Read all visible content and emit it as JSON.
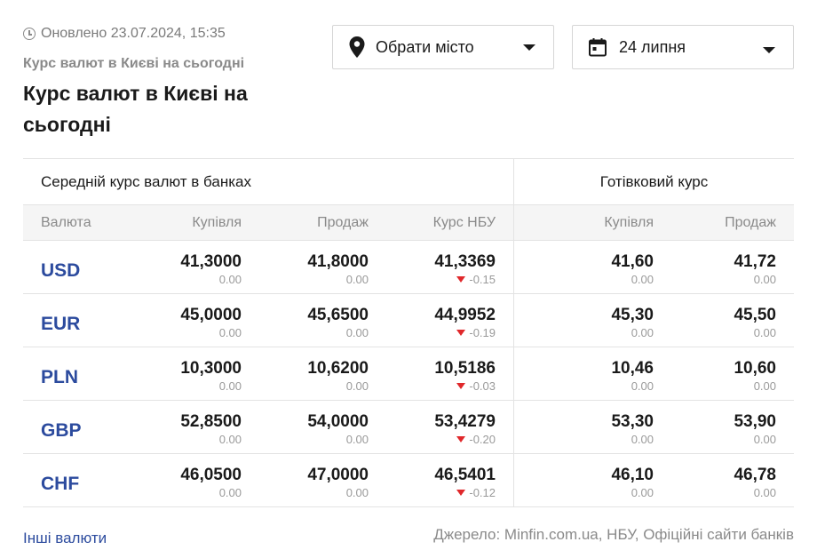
{
  "header": {
    "updated": "Оновлено 23.07.2024, 15:35",
    "breadcrumb": "Курс валют в Києві на сьогодні",
    "title": "Курс валют в Києві на сьогодні"
  },
  "filters": {
    "city_label": "Обрати місто",
    "date_label": "24 липня"
  },
  "table": {
    "bank_section": "Середній курс валют в банках",
    "cash_section": "Готівковий курс",
    "columns": {
      "currency": "Валюта",
      "buy": "Купівля",
      "sell": "Продаж",
      "nbu": "Курс НБУ",
      "cash_buy": "Купівля",
      "cash_sell": "Продаж"
    },
    "rows": [
      {
        "code": "USD",
        "buy": "41,3000",
        "buy_chg": "0.00",
        "sell": "41,8000",
        "sell_chg": "0.00",
        "nbu": "41,3369",
        "nbu_chg": "-0.15",
        "cash_buy": "41,60",
        "cash_buy_chg": "0.00",
        "cash_sell": "41,72",
        "cash_sell_chg": "0.00"
      },
      {
        "code": "EUR",
        "buy": "45,0000",
        "buy_chg": "0.00",
        "sell": "45,6500",
        "sell_chg": "0.00",
        "nbu": "44,9952",
        "nbu_chg": "-0.19",
        "cash_buy": "45,30",
        "cash_buy_chg": "0.00",
        "cash_sell": "45,50",
        "cash_sell_chg": "0.00"
      },
      {
        "code": "PLN",
        "buy": "10,3000",
        "buy_chg": "0.00",
        "sell": "10,6200",
        "sell_chg": "0.00",
        "nbu": "10,5186",
        "nbu_chg": "-0.03",
        "cash_buy": "10,46",
        "cash_buy_chg": "0.00",
        "cash_sell": "10,60",
        "cash_sell_chg": "0.00"
      },
      {
        "code": "GBP",
        "buy": "52,8500",
        "buy_chg": "0.00",
        "sell": "54,0000",
        "sell_chg": "0.00",
        "nbu": "53,4279",
        "nbu_chg": "-0.20",
        "cash_buy": "53,30",
        "cash_buy_chg": "0.00",
        "cash_sell": "53,90",
        "cash_sell_chg": "0.00"
      },
      {
        "code": "CHF",
        "buy": "46,0500",
        "buy_chg": "0.00",
        "sell": "47,0000",
        "sell_chg": "0.00",
        "nbu": "46,5401",
        "nbu_chg": "-0.12",
        "cash_buy": "46,10",
        "cash_buy_chg": "0.00",
        "cash_sell": "46,78",
        "cash_sell_chg": "0.00"
      }
    ]
  },
  "footer": {
    "other_link": "Інші валюти",
    "source": "Джерело: Minfin.com.ua, НБУ, Офіційні сайти банків"
  },
  "colors": {
    "link": "#2c4b9e",
    "down": "#e0282b",
    "muted": "#8a8a8a"
  },
  "icons": {
    "updated": "clock-icon",
    "city": "location-pin-icon",
    "date": "calendar-icon",
    "dropdown": "caret-down-icon",
    "change_down": "triangle-down-icon"
  }
}
